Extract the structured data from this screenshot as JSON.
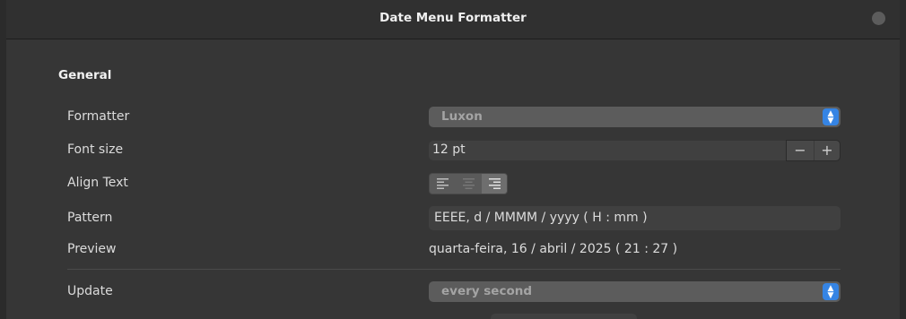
{
  "window": {
    "title": "Date Menu Formatter"
  },
  "section": {
    "title": "General"
  },
  "rows": {
    "formatter": {
      "label": "Formatter",
      "value": "Luxon"
    },
    "font_size": {
      "label": "Font size",
      "value": "12 pt",
      "minus": "−",
      "plus": "+"
    },
    "align_text": {
      "label": "Align Text",
      "options": [
        "left",
        "center",
        "right"
      ],
      "selected": "right"
    },
    "pattern": {
      "label": "Pattern",
      "value": "EEEE, d / MMMM / yyyy  ( H : mm )"
    },
    "preview": {
      "label": "Preview",
      "value": "quarta-feira, 16 / abril / 2025  ( 21 : 27 )"
    },
    "update": {
      "label": "Update",
      "value": "every second"
    }
  },
  "icons": {
    "dropdown_arrow": "⌃⌄"
  },
  "colors": {
    "accent": "#3584e4",
    "window_bg": "#363636",
    "headerbar_bg": "#303030"
  }
}
